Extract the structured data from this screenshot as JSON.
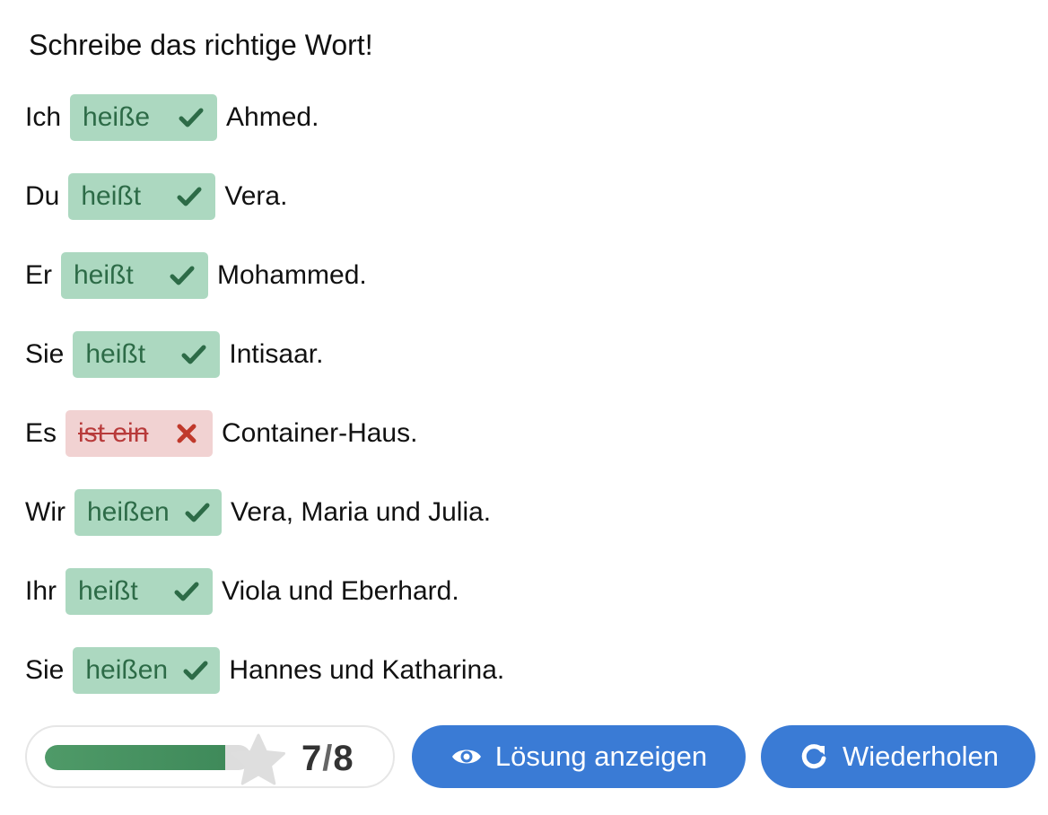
{
  "title": "Schreibe das richtige Wort!",
  "rows": [
    {
      "pre": "Ich",
      "answer": "heiße",
      "post": "Ahmed.",
      "status": "correct"
    },
    {
      "pre": "Du",
      "answer": "heißt",
      "post": "Vera.",
      "status": "correct"
    },
    {
      "pre": "Er",
      "answer": "heißt",
      "post": "Mohammed.",
      "status": "correct"
    },
    {
      "pre": "Sie",
      "answer": "heißt",
      "post": "Intisaar.",
      "status": "correct"
    },
    {
      "pre": "Es",
      "answer": "ist ein",
      "post": "Container-Haus.",
      "status": "wrong"
    },
    {
      "pre": "Wir",
      "answer": "heißen",
      "post": "Vera, Maria und Julia.",
      "status": "correct"
    },
    {
      "pre": "Ihr",
      "answer": "heißt",
      "post": "Viola und Eberhard.",
      "status": "correct"
    },
    {
      "pre": "Sie",
      "answer": "heißen",
      "post": "Hannes und Katharina.",
      "status": "correct"
    }
  ],
  "score": {
    "correct": "7",
    "total": "8",
    "progress_fraction": 0.875
  },
  "buttons": {
    "solution_label": "Lösung anzeigen",
    "retry_label": "Wiederholen"
  },
  "icons": {
    "correct": "check-icon",
    "wrong": "cross-icon",
    "score": "star-icon",
    "solution": "eye-icon",
    "retry": "redo-icon"
  },
  "colors": {
    "correct_bg": "#acd8c0",
    "correct_text": "#2d6b47",
    "wrong_bg": "#f1d2d2",
    "wrong_text": "#b83a3a",
    "button": "#3a7bd5",
    "progress": "#4f9a68"
  }
}
